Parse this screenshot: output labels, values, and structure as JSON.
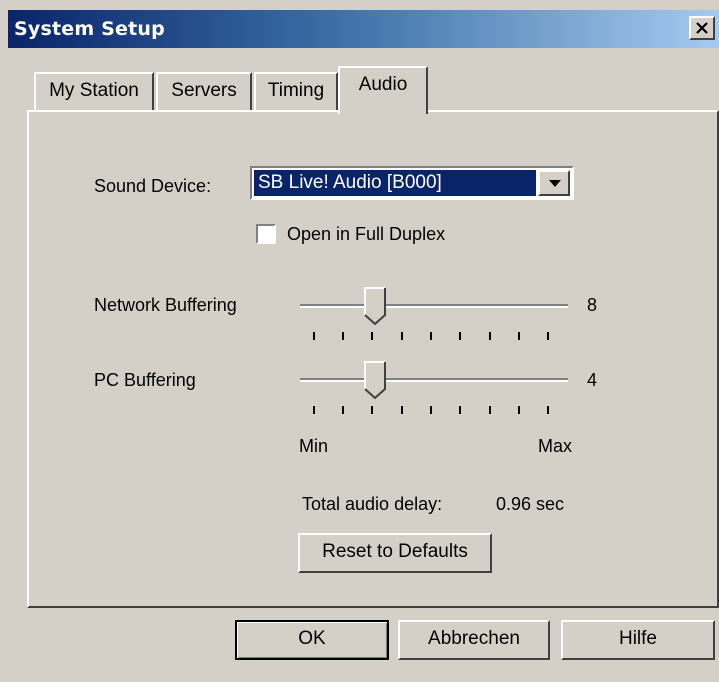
{
  "window": {
    "title": "System Setup"
  },
  "tabs": [
    {
      "label": "My Station",
      "active": false
    },
    {
      "label": "Servers",
      "active": false
    },
    {
      "label": "Timing",
      "active": false
    },
    {
      "label": "Audio",
      "active": true
    }
  ],
  "audio": {
    "sound_device_label": "Sound Device:",
    "sound_device_value": "SB Live! Audio [B000]",
    "full_duplex_label": "Open in Full Duplex",
    "full_duplex_checked": false,
    "network_buffering_label": "Network Buffering",
    "network_buffering_value": "8",
    "pc_buffering_label": "PC Buffering",
    "pc_buffering_value": "4",
    "scale_min": "Min",
    "scale_max": "Max",
    "total_delay_label": "Total audio delay:",
    "total_delay_value": "0.96 sec",
    "reset_button": "Reset to Defaults"
  },
  "footer": {
    "ok": "OK",
    "cancel": "Abbrechen",
    "help": "Hilfe"
  },
  "icons": {
    "close": "close-icon",
    "dropdown": "chevron-down-icon"
  }
}
